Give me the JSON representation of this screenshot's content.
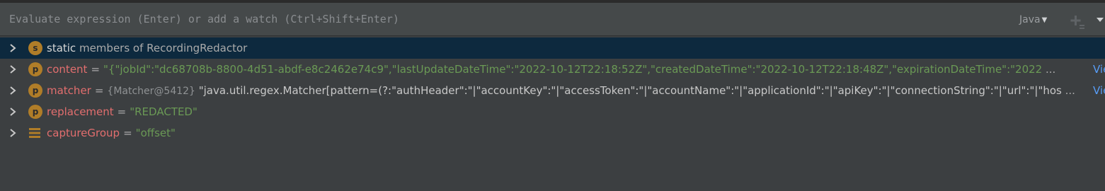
{
  "evaluate": {
    "placeholder": "Evaluate expression (Enter) or add a watch (Ctrl+Shift+Enter)",
    "language": "Java"
  },
  "icons": {
    "expand": "chevron-right-icon",
    "static_badge": "static-members-icon",
    "property_badge": "property-icon",
    "field": "field-icon",
    "add_watch": "add-watch-icon",
    "menu": "more-menu-icon"
  },
  "colors": {
    "background": "#3c3f41",
    "eval_bar": "#45494a",
    "selected_row": "#0d293e",
    "field_name": "#e26e6e",
    "string_value": "#6a9955",
    "link": "#589df6",
    "badge": "#b07d28"
  },
  "variables": [
    {
      "badge": "s",
      "name": "static",
      "suffix": "members of RecordingRedactor"
    },
    {
      "badge": "p",
      "name": "content",
      "value": "\"{\"jobId\":\"dc68708b-8800-4d51-abdf-e8c2462e74c9\",\"lastUpdateDateTime\":\"2022-10-12T22:18:52Z\",\"createdDateTime\":\"2022-10-12T22:18:48Z\",\"expirationDateTime\":\"2022",
      "ellipsis": "...",
      "link": "View"
    },
    {
      "badge": "p",
      "name": "matcher",
      "ref": "{Matcher@5412}",
      "value": "\"java.util.regex.Matcher[pattern=(?:\"authHeader\":\"|\"accountKey\":\"|\"accessToken\":\"|\"accountName\":\"|\"applicationId\":\"|\"apiKey\":\"|\"connectionString\":\"|\"url\":\"|\"hos",
      "ellipsis": "...",
      "link": "View"
    },
    {
      "badge": "p",
      "name": "replacement",
      "value": "\"REDACTED\""
    },
    {
      "badge": "field",
      "name": "captureGroup",
      "value": "\"offset\""
    }
  ]
}
